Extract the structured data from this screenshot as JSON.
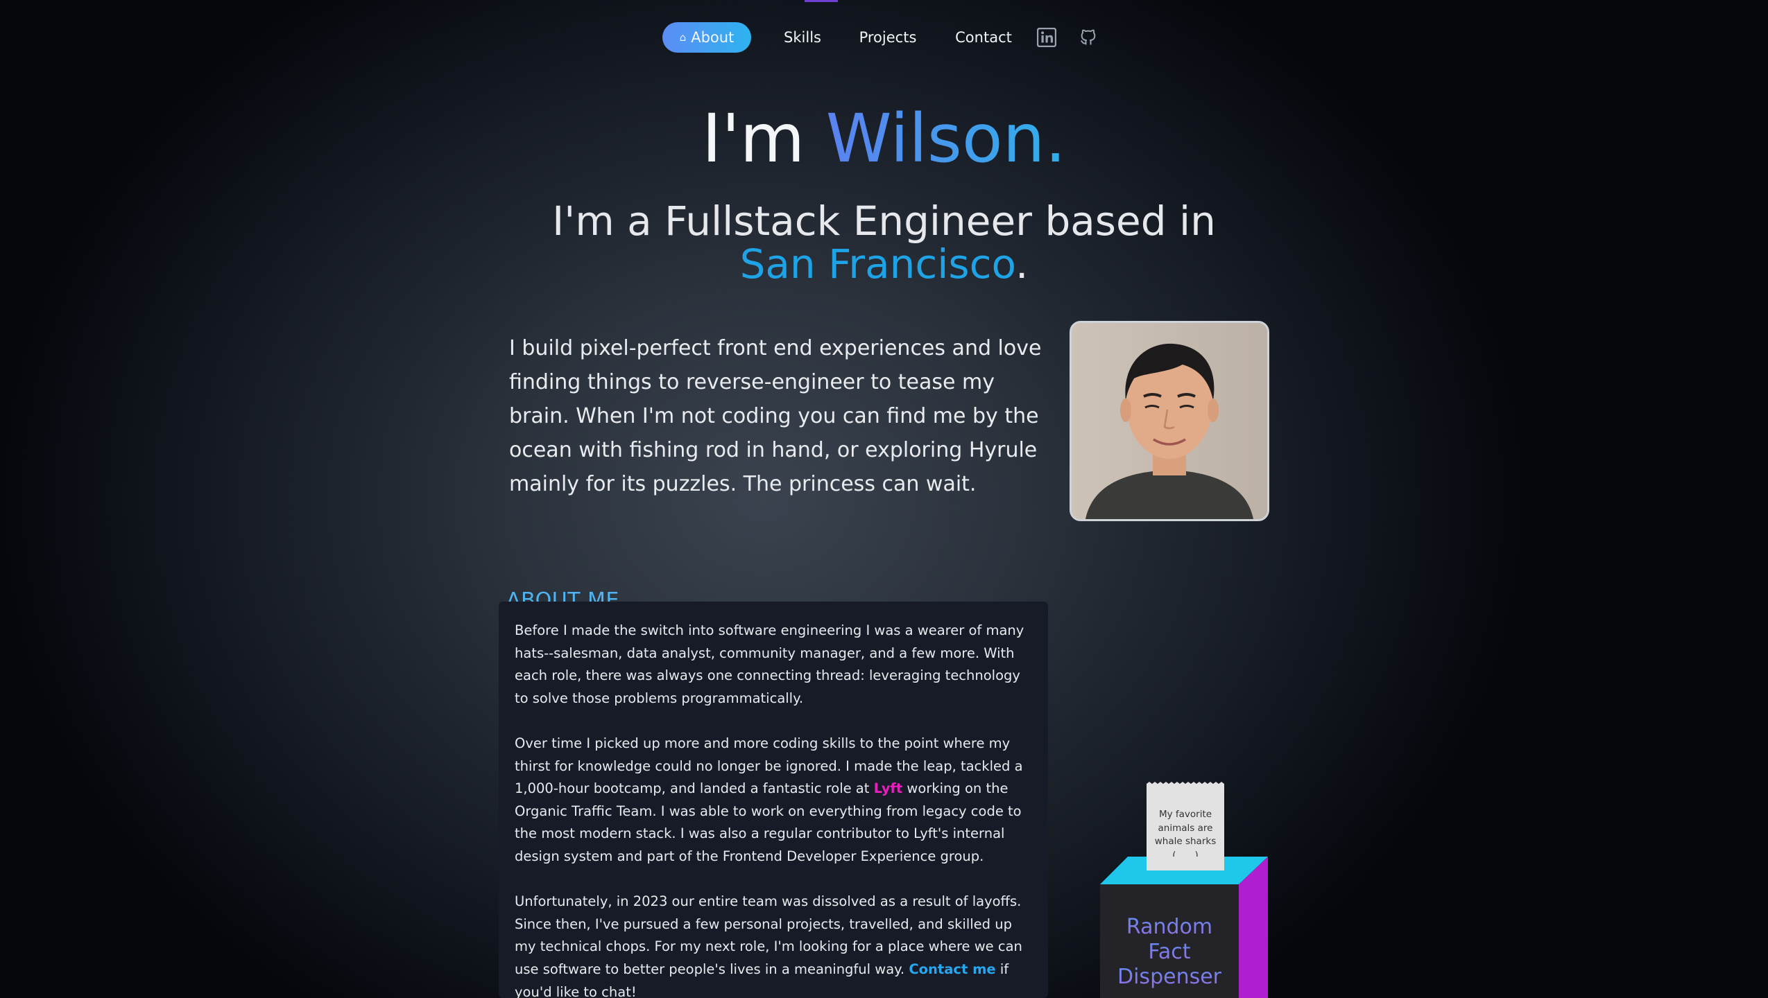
{
  "nav": {
    "items": [
      {
        "label": "About",
        "active": true,
        "icon": "home-icon"
      },
      {
        "label": "Skills",
        "active": false
      },
      {
        "label": "Projects",
        "active": false
      },
      {
        "label": "Contact",
        "active": false
      }
    ],
    "social_icons": [
      "linkedin-icon",
      "github-icon"
    ]
  },
  "hero": {
    "greeting": "I'm ",
    "name": "Wilson.",
    "subtitle_line1": "I'm a Fullstack Engineer based in",
    "city": "San Francisco",
    "city_suffix": "."
  },
  "intro": {
    "text": "I build pixel-perfect front end experiences and love finding things to reverse-engineer to tease my brain. When I'm not coding you can find me by the ocean with fishing rod in hand, or exploring Hyrule mainly for its puzzles. The princess can wait."
  },
  "about": {
    "heading": "ABOUT ME",
    "p1": "Before I made the switch into software engineering I was a wearer of many hats--salesman, data analyst, community manager, and a few more. With each role, there was always one connecting thread: leveraging technology to solve those problems programmatically.",
    "p2_before": "Over time I picked up more and more coding skills to the point where my thirst for knowledge could no longer be ignored. I made the leap, tackled a 1,000-hour bootcamp, and landed a fantastic role at ",
    "p2_highlight": "Lyft",
    "p2_after": " working on the Organic Traffic Team. I was able to work on everything from legacy code to the most modern stack. I was also a regular  contributor to Lyft's internal design system and part of the Frontend Developer Experience group.",
    "p3_before": "Unfortunately, in 2023 our entire team was dissolved as a result of layoffs. Since then, I've pursued a few personal projects, travelled, and skilled up my technical chops. For my next role, I'm looking for a place where we can use software to better people's lives in a meaningful way. ",
    "p3_link": "Contact me",
    "p3_after": " if you'd like to chat!"
  },
  "dispenser": {
    "receipt_line1": "My favorite",
    "receipt_line2": "animals are",
    "receipt_line3": "whale sharks",
    "receipt_line4": "(____)",
    "label_line1": "Random",
    "label_line2": "Fact",
    "label_line3": "Dispenser"
  },
  "colors": {
    "accent_blue": "#2eb3ef",
    "accent_gradient_start": "#5b8df5",
    "lyft_pink": "#e71fbd",
    "dispenser_cyan": "#1fc8ea",
    "dispenser_magenta": "#b01fcf"
  }
}
